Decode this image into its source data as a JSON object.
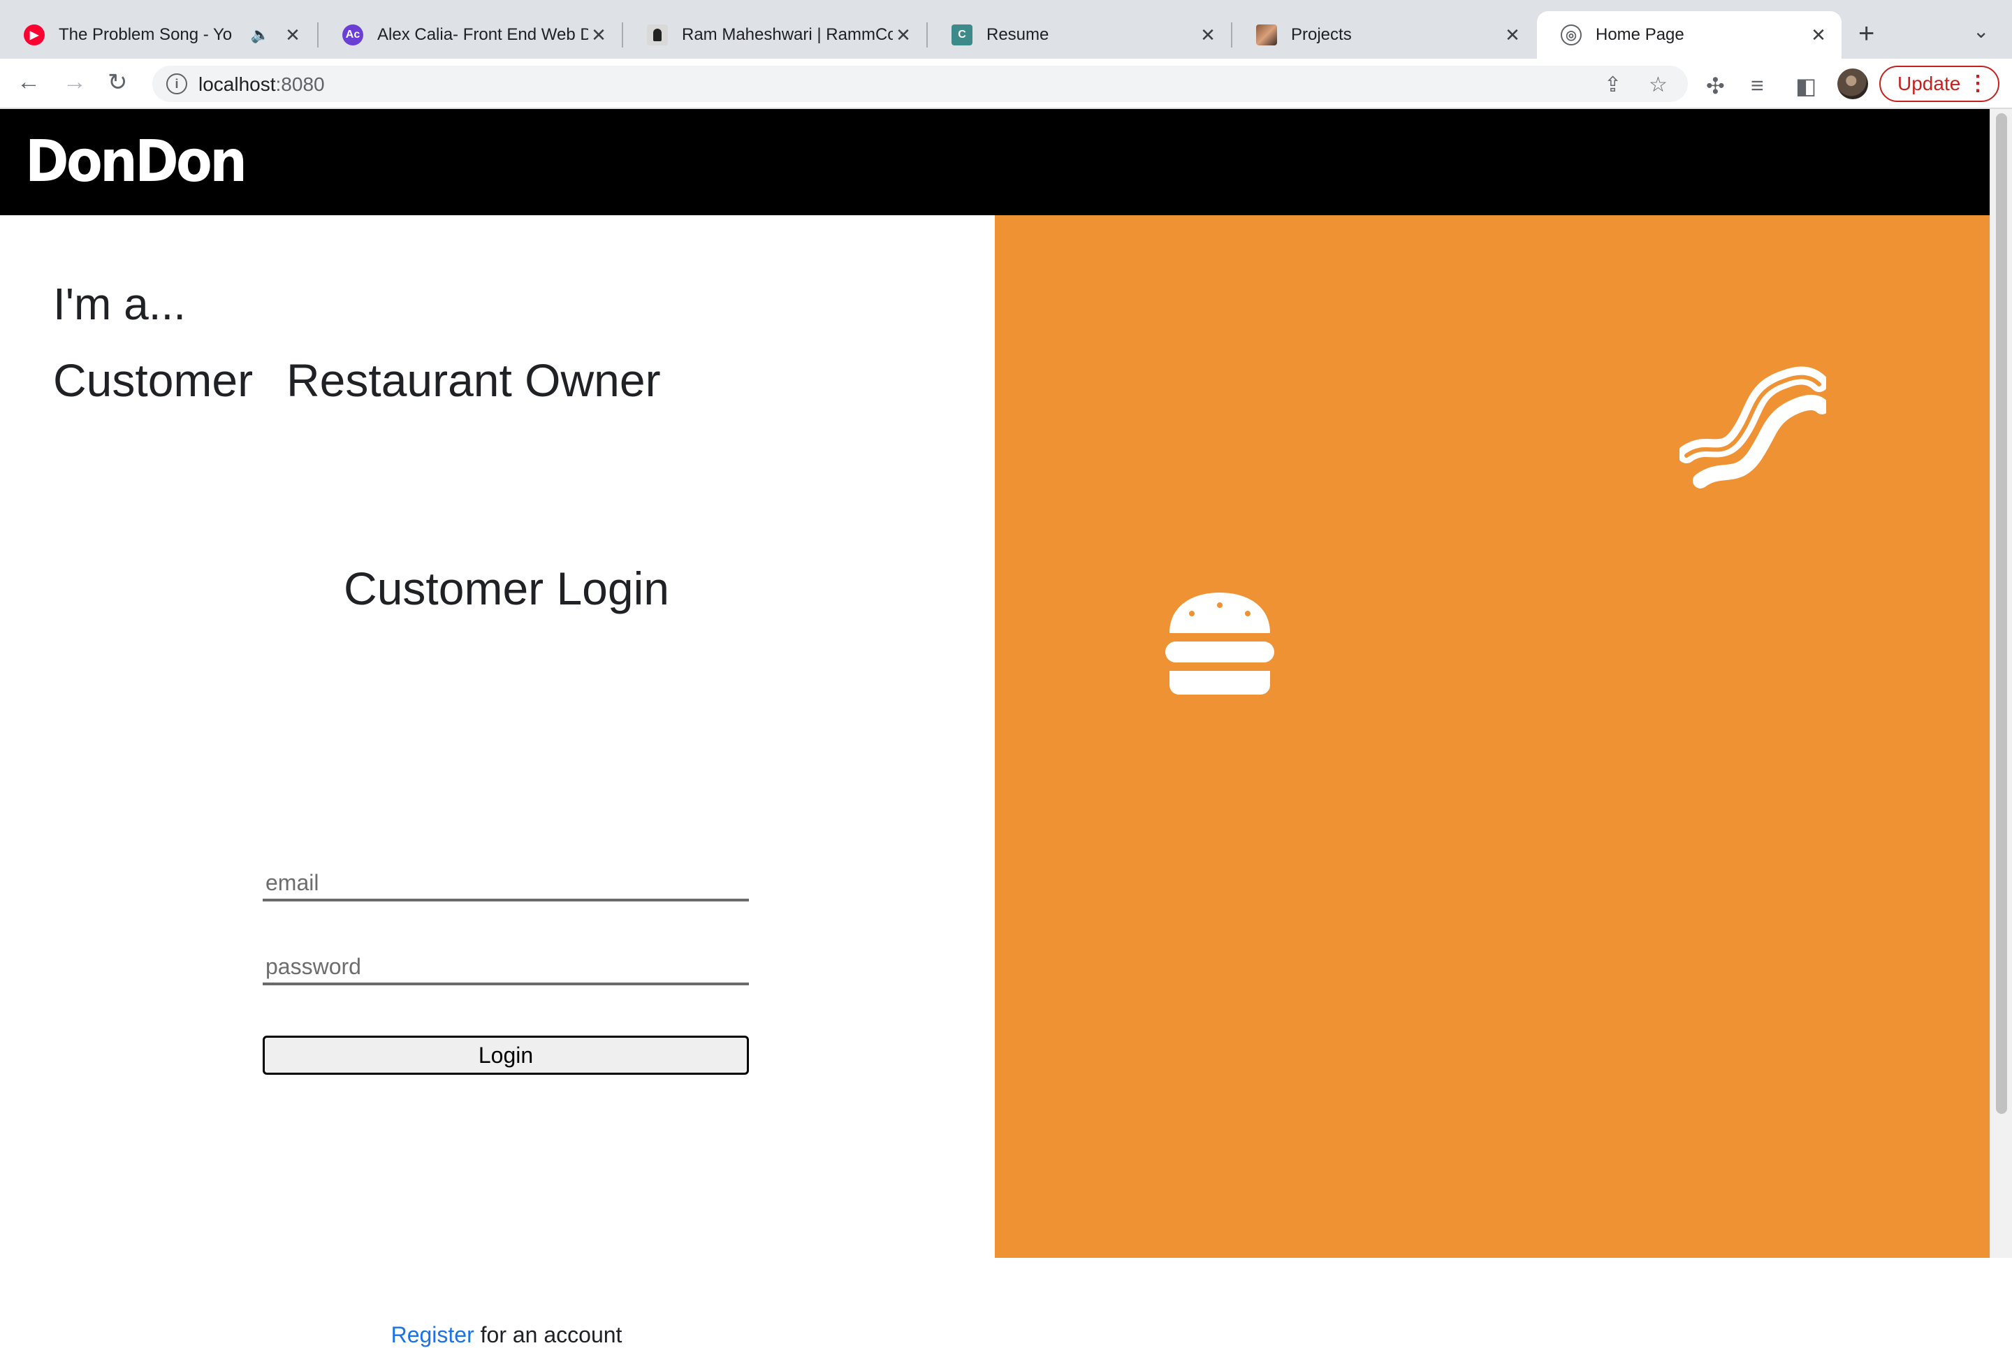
{
  "browser": {
    "tabs": [
      {
        "title": "The Problem Song - Yo",
        "favicon": "youtube-music-icon",
        "audio": true
      },
      {
        "title": "Alex Calia- Front End Web D",
        "favicon": "ac-icon"
      },
      {
        "title": "Ram Maheshwari | RammCo",
        "favicon": "portrait-icon"
      },
      {
        "title": "Resume",
        "favicon": "c-icon"
      },
      {
        "title": "Projects",
        "favicon": "photo-icon"
      },
      {
        "title": "Home Page",
        "favicon": "globe-icon",
        "active": true
      }
    ],
    "url_host": "localhost",
    "url_port": ":8080",
    "update_label": "Update",
    "accent": "#c5221f"
  },
  "header": {
    "logo": "DonDon",
    "background": "#000000"
  },
  "left": {
    "prompt": "I'm a...",
    "roles": [
      "Customer",
      "Restaurant Owner"
    ],
    "login_title": "Customer Login",
    "email_placeholder": "email",
    "password_placeholder": "password",
    "login_label": "Login",
    "register_link": "Register",
    "register_rest": " for an account",
    "link_color": "#1a73e8"
  },
  "right": {
    "background": "#ef9234",
    "icons": [
      "bacon-icon",
      "burger-icon",
      "rice-bowl-icon"
    ]
  }
}
